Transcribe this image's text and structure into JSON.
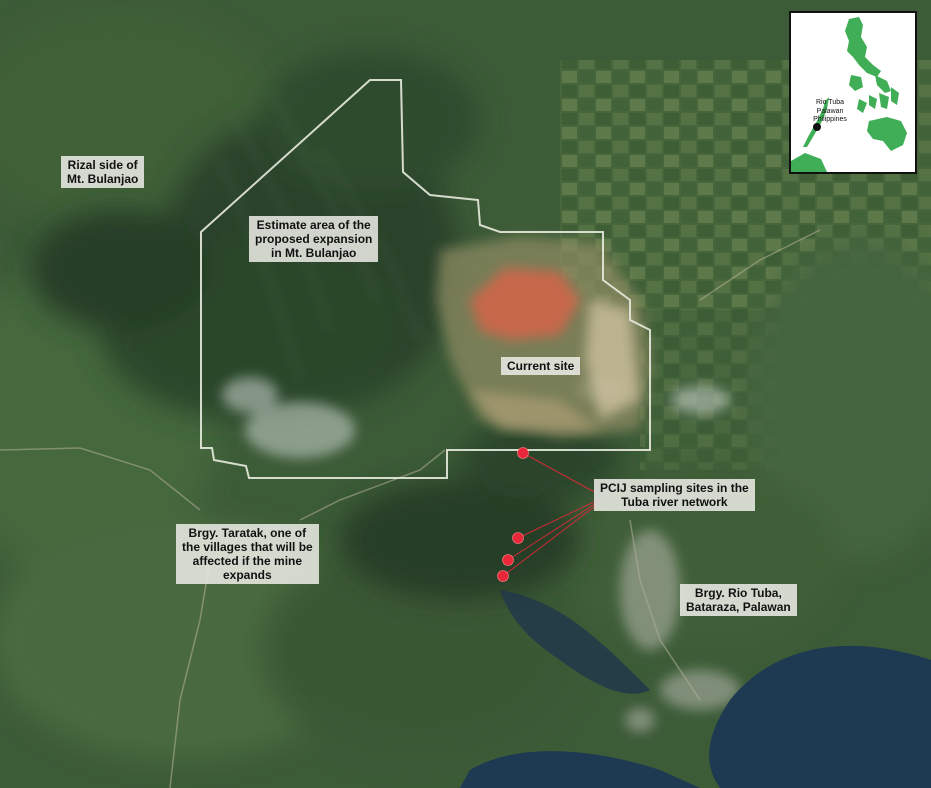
{
  "map": {
    "labels": {
      "rizal_side": [
        "Rizal side of",
        "Mt. Bulanjao"
      ],
      "expansion": [
        "Estimate area of the",
        "proposed expansion",
        "in Mt. Bulanjao"
      ],
      "current_site": [
        "Current site"
      ],
      "sampling": [
        "PCIJ sampling sites in the",
        "Tuba river network"
      ],
      "taratak": [
        "Brgy. Taratak, one of",
        "the villages that will be",
        "affected if the mine",
        "expands"
      ],
      "rio_tuba": [
        "Brgy. Rio Tuba,",
        "Bataraza, Palawan"
      ]
    },
    "colors": {
      "boundary": "#e4e8da",
      "sampling_marker": "#e8283a",
      "forest_dark": "#27402a",
      "mine_pit": "#c8684c",
      "sea": "#1e3a52"
    }
  },
  "inset": {
    "location_lines": [
      "Rio Tuba",
      "Palawan",
      "Philippines"
    ],
    "marker_icon": "location-dot-icon",
    "land_color": "#3fae56",
    "sea_color": "#ffffff"
  }
}
